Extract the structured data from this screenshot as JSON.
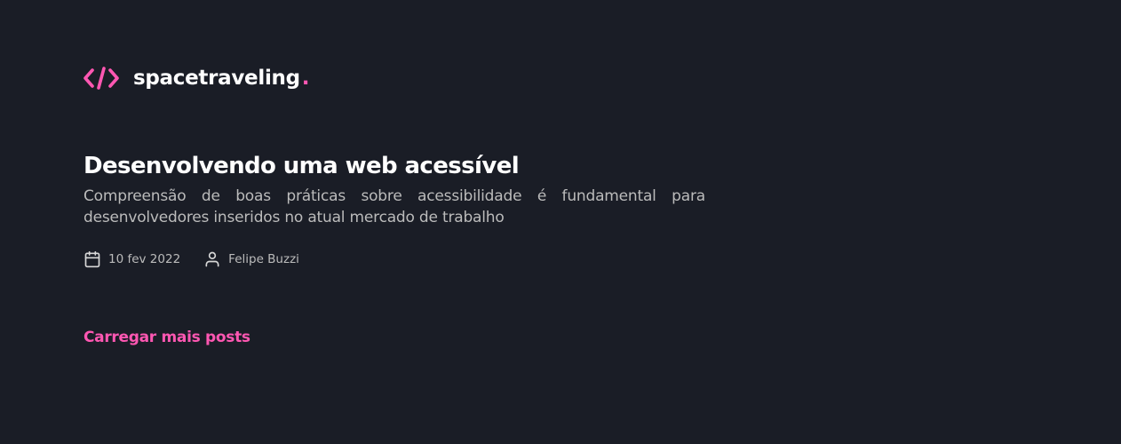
{
  "header": {
    "logo_icon": "code-brackets-icon",
    "logo_text": "spacetraveling",
    "logo_dot": "."
  },
  "post": {
    "title": "Desenvolvendo uma web acessível",
    "subtitle": "Compreensão de boas práticas sobre acessibilidade é fundamental para desenvolvedores inseridos no atual mercado de trabalho",
    "date_icon": "calendar-icon",
    "date": "10 fev 2022",
    "author_icon": "user-icon",
    "author": "Felipe Buzzi"
  },
  "load_more": {
    "label": "Carregar mais posts"
  },
  "colors": {
    "background": "#1a1d26",
    "accent": "#ff57b2",
    "title": "#ffffff",
    "text": "#bbbbbb"
  }
}
